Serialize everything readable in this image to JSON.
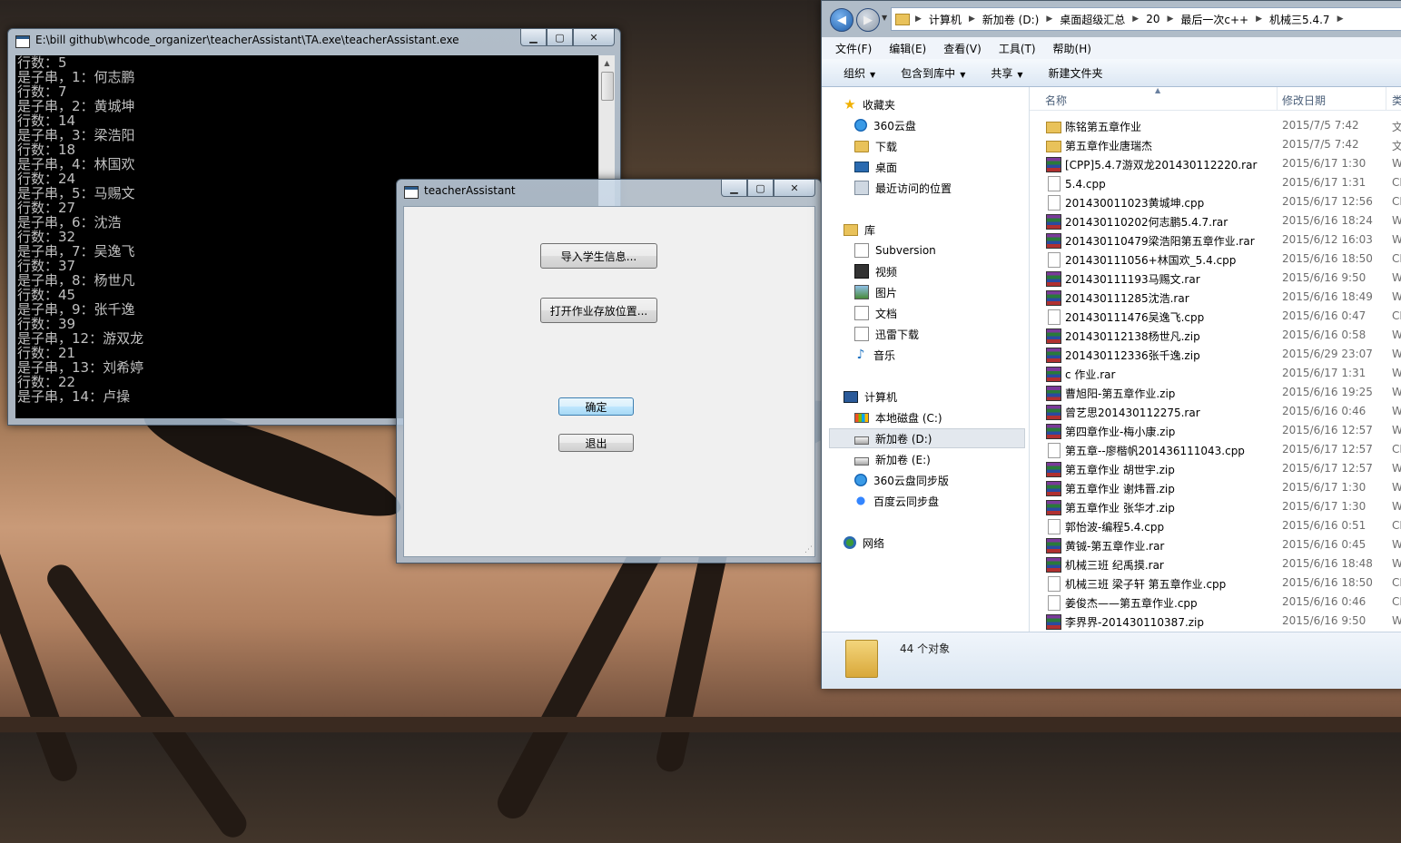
{
  "console": {
    "title": "E:\\bill github\\whcode_organizer\\teacherAssistant\\TA.exe\\teacherAssistant.exe",
    "lines": [
      "行数：5",
      "是子串，1：何志鹏",
      "行数：7",
      "是子串，2：黄城坤",
      "行数：14",
      "是子串，3：梁浩阳",
      "行数：18",
      "是子串，4：林国欢",
      "行数：24",
      "是子串，5：马赐文",
      "行数：27",
      "是子串，6：沈浩",
      "行数：32",
      "是子串，7：吴逸飞",
      "行数：37",
      "是子串，8：杨世凡",
      "行数：45",
      "是子串，9：张千逸",
      "行数：39",
      "是子串，12：游双龙",
      "行数：21",
      "是子串，13：刘希婷",
      "行数：22",
      "是子串，14：卢操"
    ]
  },
  "ta": {
    "title": "teacherAssistant",
    "import_label": "导入学生信息...",
    "open_label": "打开作业存放位置...",
    "ok_label": "确定",
    "exit_label": "退出"
  },
  "explorer": {
    "breadcrumbs": [
      "计算机",
      "新加卷 (D:)",
      "桌面超级汇总",
      "20",
      "最后一次c++",
      "机械三5.4.7"
    ],
    "menu": [
      "文件(F)",
      "编辑(E)",
      "查看(V)",
      "工具(T)",
      "帮助(H)"
    ],
    "toolbar": [
      "组织",
      "包含到库中",
      "共享",
      "新建文件夹"
    ],
    "nav": {
      "favorites": "收藏夹",
      "fav_items": [
        "360云盘",
        "下载",
        "桌面",
        "最近访问的位置"
      ],
      "library": "库",
      "lib_items": [
        "Subversion",
        "视频",
        "图片",
        "文档",
        "迅雷下载",
        "音乐"
      ],
      "computer": "计算机",
      "pc_items": [
        "本地磁盘 (C:)",
        "新加卷 (D:)",
        "新加卷 (E:)",
        "360云盘同步版",
        "百度云同步盘"
      ],
      "network": "网络"
    },
    "columns": {
      "name": "名称",
      "date": "修改日期",
      "type": "类"
    },
    "files": [
      {
        "name": "陈铭第五章作业",
        "date": "2015/7/5 7:42",
        "type": "文",
        "icon": "folder"
      },
      {
        "name": "第五章作业唐瑞杰",
        "date": "2015/7/5 7:42",
        "type": "文",
        "icon": "folder"
      },
      {
        "name": "[CPP]5.4.7游双龙201430112220.rar",
        "date": "2015/6/17 1:30",
        "type": "W",
        "icon": "rar"
      },
      {
        "name": "5.4.cpp",
        "date": "2015/6/17 1:31",
        "type": "CP",
        "icon": "cpp"
      },
      {
        "name": "201430011023黄城坤.cpp",
        "date": "2015/6/17 12:56",
        "type": "CP",
        "icon": "cpp"
      },
      {
        "name": "201430110202何志鹏5.4.7.rar",
        "date": "2015/6/16 18:24",
        "type": "W",
        "icon": "rar"
      },
      {
        "name": "201430110479梁浩阳第五章作业.rar",
        "date": "2015/6/12 16:03",
        "type": "W",
        "icon": "rar"
      },
      {
        "name": "201430111056+林国欢_5.4.cpp",
        "date": "2015/6/16 18:50",
        "type": "CP",
        "icon": "cpp"
      },
      {
        "name": "201430111193马赐文.rar",
        "date": "2015/6/16 9:50",
        "type": "W",
        "icon": "rar"
      },
      {
        "name": "201430111285沈浩.rar",
        "date": "2015/6/16 18:49",
        "type": "W",
        "icon": "rar"
      },
      {
        "name": "201430111476吴逸飞.cpp",
        "date": "2015/6/16 0:47",
        "type": "CP",
        "icon": "cpp"
      },
      {
        "name": "201430112138杨世凡.zip",
        "date": "2015/6/16 0:58",
        "type": "W",
        "icon": "rar"
      },
      {
        "name": "201430112336张千逸.zip",
        "date": "2015/6/29 23:07",
        "type": "W",
        "icon": "rar"
      },
      {
        "name": "c  作业.rar",
        "date": "2015/6/17 1:31",
        "type": "W",
        "icon": "rar"
      },
      {
        "name": "曹旭阳-第五章作业.zip",
        "date": "2015/6/16 19:25",
        "type": "W",
        "icon": "rar"
      },
      {
        "name": "曾艺思201430112275.rar",
        "date": "2015/6/16 0:46",
        "type": "W",
        "icon": "rar"
      },
      {
        "name": "第四章作业-梅小康.zip",
        "date": "2015/6/16 12:57",
        "type": "W",
        "icon": "rar"
      },
      {
        "name": "第五章--廖楷帆201436111043.cpp",
        "date": "2015/6/17 12:57",
        "type": "CP",
        "icon": "cpp"
      },
      {
        "name": "第五章作业 胡世宇.zip",
        "date": "2015/6/17 12:57",
        "type": "W",
        "icon": "rar"
      },
      {
        "name": "第五章作业 谢炜晋.zip",
        "date": "2015/6/17 1:30",
        "type": "W",
        "icon": "rar"
      },
      {
        "name": "第五章作业 张华才.zip",
        "date": "2015/6/17 1:30",
        "type": "W",
        "icon": "rar"
      },
      {
        "name": "郭怡波-编程5.4.cpp",
        "date": "2015/6/16 0:51",
        "type": "CP",
        "icon": "cpp"
      },
      {
        "name": "黄铖-第五章作业.rar",
        "date": "2015/6/16 0:45",
        "type": "W",
        "icon": "rar"
      },
      {
        "name": "机械三班 纪禹摸.rar",
        "date": "2015/6/16 18:48",
        "type": "W",
        "icon": "rar"
      },
      {
        "name": "机械三班 梁子轩 第五章作业.cpp",
        "date": "2015/6/16 18:50",
        "type": "CP",
        "icon": "cpp"
      },
      {
        "name": "姜俊杰——第五章作业.cpp",
        "date": "2015/6/16 0:46",
        "type": "CP",
        "icon": "cpp"
      },
      {
        "name": "李界界-201430110387.zip",
        "date": "2015/6/16 9:50",
        "type": "W",
        "icon": "rar"
      }
    ],
    "status": "44 个对象"
  },
  "colors": {
    "console_bg": "#000000",
    "console_text": "#c0c0c0",
    "default_button": "#3c7fb1",
    "selection": "#e3e8ee"
  }
}
